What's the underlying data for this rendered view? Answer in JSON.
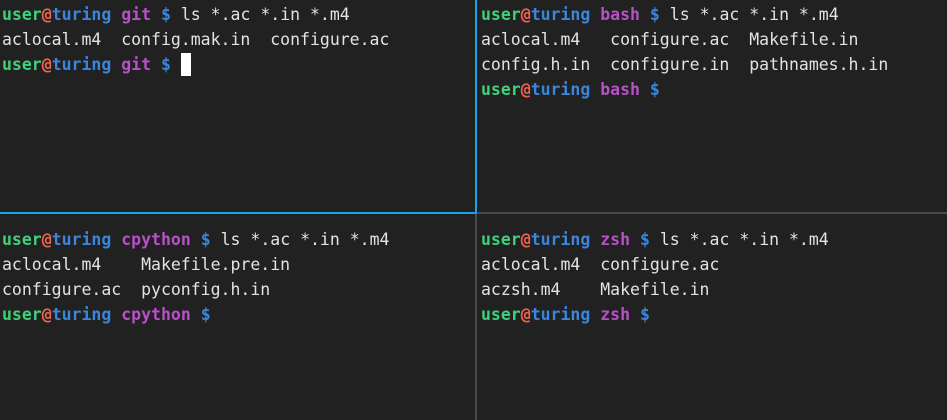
{
  "colors": {
    "background": "#212121",
    "active_border": "#16a4f0",
    "inactive_border": "#4a4a4a",
    "user": "#3fd07a",
    "at": "#ef6450",
    "host": "#3a86dc",
    "dir": "#b850c8"
  },
  "panes": [
    {
      "name": "git",
      "active": true,
      "prompt": {
        "user": "user",
        "at": "@",
        "host": "turing",
        "dir": "git",
        "symbol": "$"
      },
      "command": "ls *.ac *.in *.m4",
      "output": [
        "aclocal.m4  config.mak.in  configure.ac"
      ],
      "cursor": true
    },
    {
      "name": "bash",
      "active": false,
      "prompt": {
        "user": "user",
        "at": "@",
        "host": "turing",
        "dir": "bash",
        "symbol": "$"
      },
      "command": "ls *.ac *.in *.m4",
      "output": [
        "aclocal.m4   configure.ac  Makefile.in",
        "config.h.in  configure.in  pathnames.h.in"
      ],
      "cursor": false
    },
    {
      "name": "cpython",
      "active": false,
      "prompt": {
        "user": "user",
        "at": "@",
        "host": "turing",
        "dir": "cpython",
        "symbol": "$"
      },
      "command": "ls *.ac *.in *.m4",
      "output": [
        "aclocal.m4    Makefile.pre.in",
        "configure.ac  pyconfig.h.in"
      ],
      "cursor": false
    },
    {
      "name": "zsh",
      "active": false,
      "prompt": {
        "user": "user",
        "at": "@",
        "host": "turing",
        "dir": "zsh",
        "symbol": "$"
      },
      "command": "ls *.ac *.in *.m4",
      "output": [
        "aclocal.m4  configure.ac",
        "aczsh.m4    Makefile.in"
      ],
      "cursor": false
    }
  ]
}
